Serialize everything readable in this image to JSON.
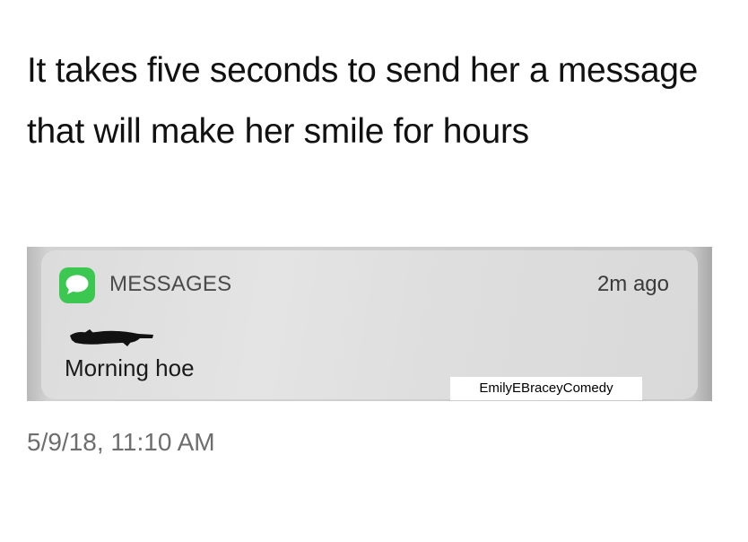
{
  "tweet": {
    "text": "It takes five seconds to send her a message that will make her smile for hours",
    "timestamp": "5/9/18, 11:10 AM"
  },
  "notification": {
    "app_icon": "messages-bubble-icon",
    "app_name": "MESSAGES",
    "time_ago": "2m ago",
    "sender": "",
    "body": "Morning hoe"
  },
  "watermark": {
    "text": "EmilyEBraceyComedy"
  },
  "colors": {
    "messages_green": "#3cc850",
    "notification_bg": "#e0e0e0",
    "timestamp_gray": "#6e6e6e"
  }
}
